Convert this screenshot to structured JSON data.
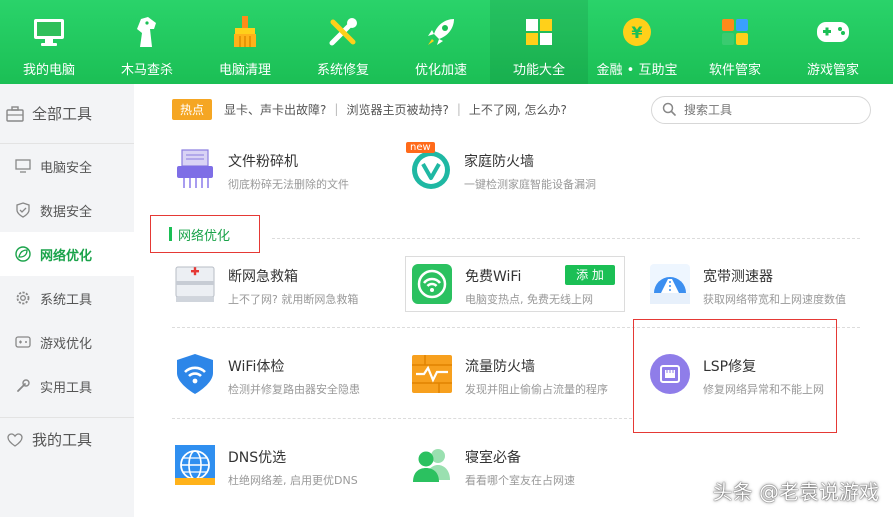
{
  "toolbar": {
    "items": [
      {
        "label": "我的电脑",
        "icon": "monitor-icon"
      },
      {
        "label": "木马查杀",
        "icon": "horse-icon"
      },
      {
        "label": "电脑清理",
        "icon": "broom-icon"
      },
      {
        "label": "系统修复",
        "icon": "wrench-icon"
      },
      {
        "label": "优化加速",
        "icon": "rocket-icon"
      },
      {
        "label": "功能大全",
        "icon": "grid-icon"
      },
      {
        "label": "金融 • 互助宝",
        "icon": "yuan-coin-icon"
      },
      {
        "label": "软件管家",
        "icon": "apps-icon"
      },
      {
        "label": "游戏管家",
        "icon": "gamepad-icon"
      }
    ],
    "active_index": 5
  },
  "sidebar": {
    "header": "全部工具",
    "items": [
      {
        "label": "电脑安全"
      },
      {
        "label": "数据安全"
      },
      {
        "label": "网络优化"
      },
      {
        "label": "系统工具"
      },
      {
        "label": "游戏优化"
      },
      {
        "label": "实用工具"
      }
    ],
    "active_index": 2,
    "footer": "我的工具"
  },
  "hotbar": {
    "badge": "热点",
    "links": [
      "显卡、声卡出故障?",
      "浏览器主页被劫持?",
      "上不了网, 怎么办?"
    ],
    "separator": "|"
  },
  "search": {
    "placeholder": "搜索工具"
  },
  "top_tools": [
    {
      "title": "文件粉碎机",
      "desc": "彻底粉碎无法删除的文件"
    },
    {
      "title": "家庭防火墙",
      "desc": "一键检测家庭智能设备漏洞",
      "badge": "new"
    }
  ],
  "section": {
    "title": "网络优化"
  },
  "tools": [
    {
      "title": "断网急救箱",
      "desc": "上不了网? 就用断网急救箱"
    },
    {
      "title": "免费WiFi",
      "desc": "电脑变热点, 免费无线上网",
      "button": "添 加"
    },
    {
      "title": "宽带测速器",
      "desc": "获取网络带宽和上网速度数值"
    },
    {
      "title": "WiFi体检",
      "desc": "检测并修复路由器安全隐患"
    },
    {
      "title": "流量防火墙",
      "desc": "发现并阻止偷偷占流量的程序"
    },
    {
      "title": "LSP修复",
      "desc": "修复网络异常和不能上网"
    },
    {
      "title": "DNS优选",
      "desc": "杜绝网络差, 启用更优DNS"
    },
    {
      "title": "寝室必备",
      "desc": "看看哪个室友在占网速"
    }
  ],
  "watermark": "头条 @老袁说游戏",
  "colors": {
    "brand_green": "#1bbf55",
    "highlight_red": "#e53935",
    "hot_orange": "#f5a623"
  }
}
